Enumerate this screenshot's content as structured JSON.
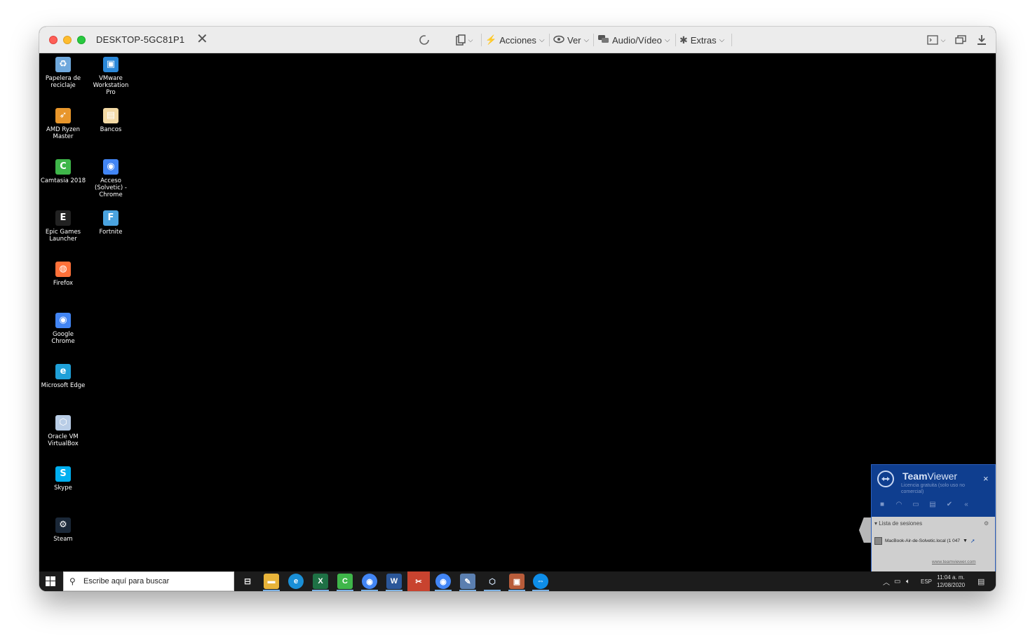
{
  "window": {
    "title": "DESKTOP-5GC81P1",
    "close_glyph": "✕"
  },
  "toolbar": {
    "menus": [
      {
        "label": "Acciones",
        "icon": "bolt-icon"
      },
      {
        "label": "Ver",
        "icon": "eye-icon"
      },
      {
        "label": "Audio/Vídeo",
        "icon": "chat-icon"
      },
      {
        "label": "Extras",
        "icon": "puzzle-icon"
      }
    ]
  },
  "desktop_icons": [
    {
      "label": "Papelera de reciclaje",
      "icon": "recycle-bin-icon",
      "color": "#6fa8dc"
    },
    {
      "label": "VMware Workstation Pro",
      "icon": "vmware-icon",
      "color": "#2b88d8"
    },
    {
      "label": "AMD Ryzen Master",
      "icon": "amd-ryzen-icon",
      "color": "#e8962b"
    },
    {
      "label": "Bancos",
      "icon": "bancos-file-icon",
      "color": "#f3d9a4"
    },
    {
      "label": "Camtasia 2018",
      "icon": "camtasia-icon",
      "color": "#3fb64a"
    },
    {
      "label": "Acceso (Solvetic) - Chrome",
      "icon": "chrome-profile-icon",
      "color": "#4285f4"
    },
    {
      "label": "Epic Games Launcher",
      "icon": "epic-games-icon",
      "color": "#222222"
    },
    {
      "label": "Fortnite",
      "icon": "fortnite-icon",
      "color": "#4aa3df"
    },
    {
      "label": "Firefox",
      "icon": "firefox-icon",
      "color": "#ff7139"
    },
    {
      "label": "Google Chrome",
      "icon": "chrome-icon",
      "color": "#4285f4"
    },
    {
      "label": "Microsoft Edge",
      "icon": "edge-icon",
      "color": "#1fa0d8"
    },
    {
      "label": "Oracle VM VirtualBox",
      "icon": "virtualbox-icon",
      "color": "#b9cde6"
    },
    {
      "label": "Skype",
      "icon": "skype-icon",
      "color": "#00aff0"
    },
    {
      "label": "Steam",
      "icon": "steam-icon",
      "color": "#1b2838"
    }
  ],
  "taskbar": {
    "search_placeholder": "Escribe aquí para buscar",
    "language": "ESP",
    "time": "11:04 a. m.",
    "date": "12/08/2020"
  },
  "teamviewer": {
    "brand_bold": "Team",
    "brand_rest": "Viewer",
    "license": "Licencia gratuita (solo uso no comercial)",
    "close_glyph": "×",
    "session_list_label": "Lista de sesiones",
    "session_name": "MacBook-Air-de-Solvetic.local (1 047",
    "website": "www.teamviewer.com"
  }
}
